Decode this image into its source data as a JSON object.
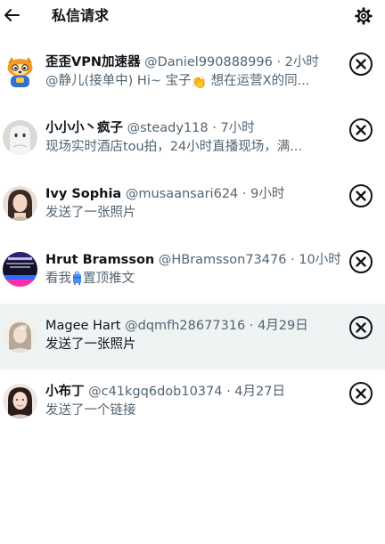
{
  "header": {
    "title": "私信请求"
  },
  "requests": [
    {
      "name": "歪歪VPN加速器",
      "handle": "@Daniel990888996",
      "time": "· 2小时",
      "preview_a": "@静儿(接单中) Hi~ 宝子",
      "preview_b": " 想在运营X的同...",
      "avatar_icon": "raccoon-mascot"
    },
    {
      "name": "小小小丶疯子",
      "handle": "@steady118",
      "time": "· 7小时",
      "preview": "现场实时酒店tou拍，24小时直播现场，满...",
      "avatar_icon": "ghost-figure"
    },
    {
      "name": "Ivy Sophia",
      "handle": "@musaansari624",
      "time": "· 9小时",
      "preview": "发送了一张照片",
      "avatar_icon": "portrait-photo"
    },
    {
      "name": "Hrut Bramsson",
      "handle": "@HBramsson73476",
      "time": "· 10小时",
      "preview_a": "看我",
      "preview_b": "置顶推文",
      "avatar_icon": "neon-graphic"
    },
    {
      "name": "Magee Hart",
      "handle": "@dqmfh28677316",
      "time": "· 4月29日",
      "preview": "发送了一张照片",
      "avatar_icon": "portrait-photo",
      "highlighted": true
    },
    {
      "name": "小布丁",
      "handle": "@c41kgq6dob10374",
      "time": "· 4月27日",
      "preview": "发送了一个链接",
      "avatar_icon": "portrait-photo"
    }
  ],
  "colors": {
    "text_primary": "#0f1419",
    "text_secondary": "#536471",
    "row_highlight": "#eff3f4"
  }
}
